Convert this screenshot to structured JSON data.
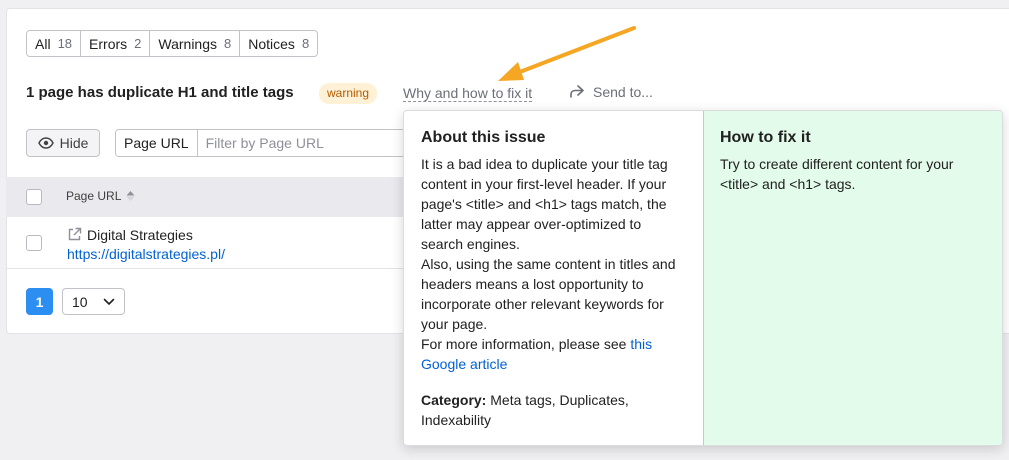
{
  "filters": [
    {
      "label": "All",
      "count": "18"
    },
    {
      "label": "Errors",
      "count": "2"
    },
    {
      "label": "Warnings",
      "count": "8"
    },
    {
      "label": "Notices",
      "count": "8"
    }
  ],
  "issue": {
    "title": "1 page has duplicate H1 and title tags",
    "badge": "warning",
    "why_link": "Why and how to fix it",
    "send_to": "Send to..."
  },
  "toolbar": {
    "hide_label": "Hide",
    "filter_label": "Page URL",
    "filter_placeholder": "Filter by Page URL"
  },
  "table": {
    "column_header": "Page URL",
    "rows": [
      {
        "title": "Digital Strategies",
        "url": "https://digitalstrategies.pl/"
      }
    ]
  },
  "pagination": {
    "current_page": "1",
    "per_page": "10"
  },
  "popover": {
    "about_title": "About this issue",
    "about_text": "It is a bad idea to duplicate your title tag content in your first-level header. If your page's <title> and <h1> tags match, the latter may appear over-optimized to search engines.",
    "about_text_2": "Also, using the same content in titles and headers means a lost opportunity to incorporate other relevant keywords for your page.",
    "more_info_prefix": "For more information, please see ",
    "more_info_link": "this Google article",
    "category_label": "Category:",
    "category_value": " Meta tags, Duplicates, Indexability",
    "fix_title": "How to fix it",
    "fix_text": "Try to create different content for your <title> and <h1> tags."
  },
  "colors": {
    "accent": "#2b8ef0",
    "link": "#0061d6",
    "warning_bg": "#fff1d6",
    "warning_text": "#b25b00",
    "fix_bg": "#e3fbea",
    "arrow": "#f5a623"
  }
}
